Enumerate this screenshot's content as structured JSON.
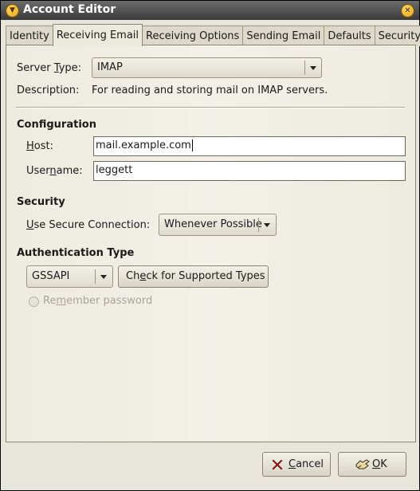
{
  "window": {
    "title": "Account Editor"
  },
  "tabs": [
    {
      "label": "Identity",
      "active": false
    },
    {
      "label": "Receiving Email",
      "active": true
    },
    {
      "label": "Receiving Options",
      "active": false
    },
    {
      "label": "Sending Email",
      "active": false
    },
    {
      "label": "Defaults",
      "active": false
    },
    {
      "label": "Security",
      "active": false
    }
  ],
  "server": {
    "type_label_pre": "Server ",
    "type_label_key": "T",
    "type_label_post": "ype:",
    "type_value": "IMAP",
    "description_label": "Description:",
    "description_value": "For reading and storing mail on IMAP servers."
  },
  "configuration": {
    "heading": "Configuration",
    "host_label_key": "H",
    "host_label_post": "ost:",
    "host_value": "mail.example.com",
    "username_label_pre": "User",
    "username_label_key": "n",
    "username_label_post": "ame:",
    "username_value": "leggett"
  },
  "security": {
    "heading": "Security",
    "secure_label_key": "U",
    "secure_label_post": "se Secure Connection:",
    "secure_value": "Whenever Possible"
  },
  "authentication": {
    "heading": "Authentication Type",
    "type_value": "GSSAPI",
    "check_pre": "Ch",
    "check_key": "e",
    "check_post": "ck for Supported Types",
    "remember_pre": "Re",
    "remember_key": "m",
    "remember_post": "ember password",
    "remember_checked": false
  },
  "buttons": {
    "cancel_key": "C",
    "cancel_post": "ancel",
    "ok_key": "O",
    "ok_post": "K"
  },
  "icons": {
    "menu": "window-menu-icon",
    "close": "window-close-icon",
    "cancel": "cancel-x-icon",
    "ok": "ok-hand-icon"
  }
}
